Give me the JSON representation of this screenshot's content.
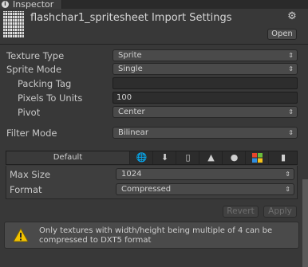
{
  "tab": {
    "label": "Inspector",
    "icon": "info-icon"
  },
  "header": {
    "title": "flashchar1_spritesheet Import Settings",
    "open_label": "Open",
    "gear_icon": "gear-icon"
  },
  "settings": {
    "texture_type": {
      "label": "Texture Type",
      "value": "Sprite"
    },
    "sprite_mode": {
      "label": "Sprite Mode",
      "value": "Single"
    },
    "packing_tag": {
      "label": "Packing Tag",
      "value": ""
    },
    "pixels_to_units": {
      "label": "Pixels To Units",
      "value": "100"
    },
    "pivot": {
      "label": "Pivot",
      "value": "Center"
    },
    "filter_mode": {
      "label": "Filter Mode",
      "value": "Bilinear"
    }
  },
  "platforms": {
    "default_label": "Default",
    "icons": [
      "globe-icon",
      "download-icon",
      "phone-icon",
      "android-icon",
      "blackberry-icon",
      "windows-icon",
      "windows-phone-icon"
    ]
  },
  "platform_settings": {
    "max_size": {
      "label": "Max Size",
      "value": "1024"
    },
    "format": {
      "label": "Format",
      "value": "Compressed"
    }
  },
  "actions": {
    "revert_label": "Revert",
    "apply_label": "Apply"
  },
  "warning": {
    "text": "Only textures with width/height being multiple of 4 can be compressed to DXT5 format"
  },
  "colors": {
    "background": "#383838",
    "panel": "#3e3e3e",
    "warning_icon": "#f2c200"
  }
}
